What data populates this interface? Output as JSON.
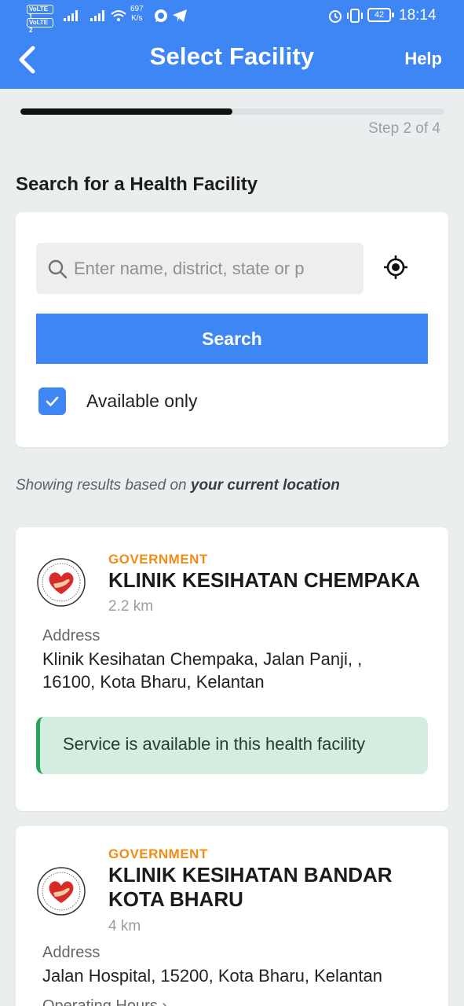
{
  "status_bar": {
    "volte1": "VoLTE 1",
    "volte2": "VoLTE 2",
    "net_speed_value": "697",
    "net_speed_unit": "K/s",
    "battery": "42",
    "time": "18:14"
  },
  "appbar": {
    "title": "Select Facility",
    "help": "Help"
  },
  "progress": {
    "fraction": 0.5,
    "label": "Step 2 of 4"
  },
  "search_section": {
    "title": "Search for a Health Facility",
    "placeholder": "Enter name, district, state or p",
    "button": "Search",
    "available_only_label": "Available only",
    "available_only_checked": true
  },
  "results_note": {
    "prefix": "Showing results based on ",
    "emphasis": "your current location"
  },
  "facilities": [
    {
      "type": "GOVERNMENT",
      "name": "KLINIK KESIHATAN CHEMPAKA",
      "distance": "2.2 km",
      "address_label": "Address",
      "address": "Klinik Kesihatan Chempaka, Jalan Panji, , 16100, Kota Bharu, Kelantan",
      "availability": "Service is available in this health facility"
    },
    {
      "type": "GOVERNMENT",
      "name": "KLINIK KESIHATAN BANDAR KOTA BHARU",
      "distance": "4 km",
      "address_label": "Address",
      "address": "Jalan Hospital, 15200, Kota Bharu, Kelantan",
      "operating_hours_label": "Operating Hours"
    }
  ],
  "colors": {
    "primary": "#3f86f5",
    "type_label": "#ef8d14",
    "available_bg": "#d3ede0",
    "available_border": "#27a35a"
  }
}
